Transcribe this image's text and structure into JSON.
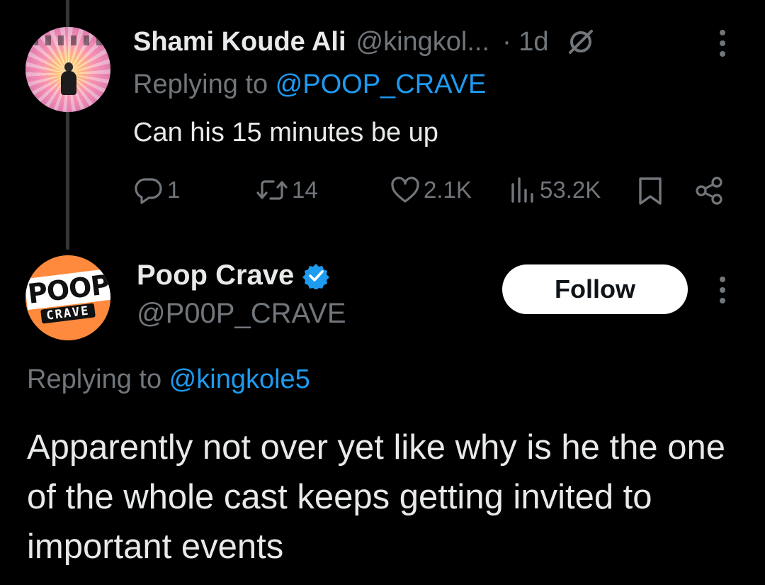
{
  "reply": {
    "name": "Shami Koude Ali",
    "handle": "@kingkol...",
    "time": "· 1d",
    "replying_prefix": "Replying to ",
    "replying_to": "@POOP_CRAVE",
    "text": "Can his 15 minutes be up",
    "stats": {
      "replies": "1",
      "reposts": "14",
      "likes": "2.1K",
      "views": "53.2K"
    }
  },
  "tweet": {
    "name": "Poop Crave",
    "handle": "@P00P_CRAVE",
    "follow_label": "Follow",
    "replying_prefix": "Replying to ",
    "replying_to": "@kingkole5",
    "text": "Apparently not over yet like why is he the one of the whole cast keeps getting invited to important events",
    "avatar_logo_top": "POOP",
    "avatar_logo_bottom": "CRAVE"
  },
  "colors": {
    "background": "#000000",
    "text": "#e7e9ea",
    "muted": "#71767b",
    "link": "#1d9bf0",
    "avatar_orange": "#ff8a3d"
  },
  "icons": {
    "reply": "reply-icon",
    "repost": "repost-icon",
    "like": "heart-icon",
    "views": "views-icon",
    "bookmark": "bookmark-icon",
    "share": "share-icon",
    "grok": "grok-icon",
    "verified": "verified-badge-icon",
    "more": "more-options-icon"
  }
}
